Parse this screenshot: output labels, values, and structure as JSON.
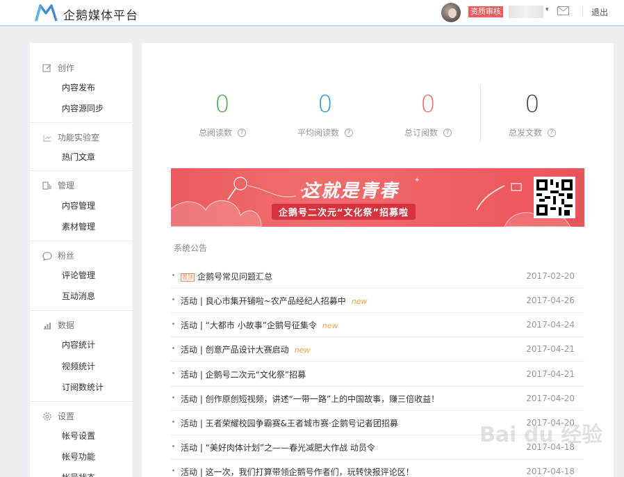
{
  "header": {
    "logo_text": "企鹅媒体平台",
    "badge": "资质审核",
    "username": "██████",
    "logout": "退出",
    "brand_color": "#3d8fd1"
  },
  "sidebar": {
    "sections": [
      {
        "title": "创作",
        "icon": "edit-icon",
        "items": [
          "内容发布",
          "内容源同步"
        ]
      },
      {
        "title": "功能实验室",
        "icon": "lab-icon",
        "items": [
          "热门文章"
        ]
      },
      {
        "title": "管理",
        "icon": "manage-icon",
        "items": [
          "内容管理",
          "素材管理"
        ]
      },
      {
        "title": "粉丝",
        "icon": "chat-icon",
        "items": [
          "评论管理",
          "互动消息"
        ]
      },
      {
        "title": "数据",
        "icon": "chart-icon",
        "items": [
          "内容统计",
          "视频统计",
          "订阅数统计"
        ]
      },
      {
        "title": "设置",
        "icon": "gear-icon",
        "items": [
          "帐号设置",
          "帐号功能",
          "帐号状态"
        ]
      }
    ]
  },
  "stats": [
    {
      "value": "0",
      "label": "总阅读数",
      "color": "#4caf50"
    },
    {
      "value": "0",
      "label": "平均阅读数",
      "color": "#2d9bd6"
    },
    {
      "value": "0",
      "label": "总订阅数",
      "color": "#f5705e"
    },
    {
      "value": "0",
      "label": "总发文数",
      "color": "#444444"
    }
  ],
  "banner": {
    "title": "这就是青春",
    "subtitle": "企鹅号二次元“文化祭”招募啦"
  },
  "announcements": {
    "title": "系统公告",
    "top_tag": "置顶",
    "new_label": "new",
    "items": [
      {
        "text": "企鹅号常见问题汇总",
        "date": "2017-02-20",
        "pinned": true,
        "new": false
      },
      {
        "text": "活动 | 良心市集开铺啦~农产品经纪人招募中",
        "date": "2017-04-26",
        "pinned": false,
        "new": true
      },
      {
        "text": "活动 | “大都市 小故事”企鹅号征集令",
        "date": "2017-04-24",
        "pinned": false,
        "new": true
      },
      {
        "text": "活动 | 创意产品设计大赛启动",
        "date": "2017-04-21",
        "pinned": false,
        "new": true
      },
      {
        "text": "活动 | 企鹅号二次元“文化祭”招募",
        "date": "2017-04-21",
        "pinned": false,
        "new": false
      },
      {
        "text": "活动 | 创作原创短视频，讲述“一带一路”上的中国故事，赚三倍收益！",
        "date": "2017-04-20",
        "pinned": false,
        "new": false
      },
      {
        "text": "活动 | 王者荣耀校园争霸赛&王者城市赛·企鹅号记者团招募",
        "date": "2017-04-20",
        "pinned": false,
        "new": false
      },
      {
        "text": "活动 | “美好肉体计划”之——春光减肥大作战 动员令",
        "date": "2017-04-18",
        "pinned": false,
        "new": false
      },
      {
        "text": "活动 | 这一次，我们打算带领企鹅号作者们，玩转快报评论区！",
        "date": "2017-04-18",
        "pinned": false,
        "new": false
      }
    ]
  },
  "watermark": "Bai du 经验"
}
